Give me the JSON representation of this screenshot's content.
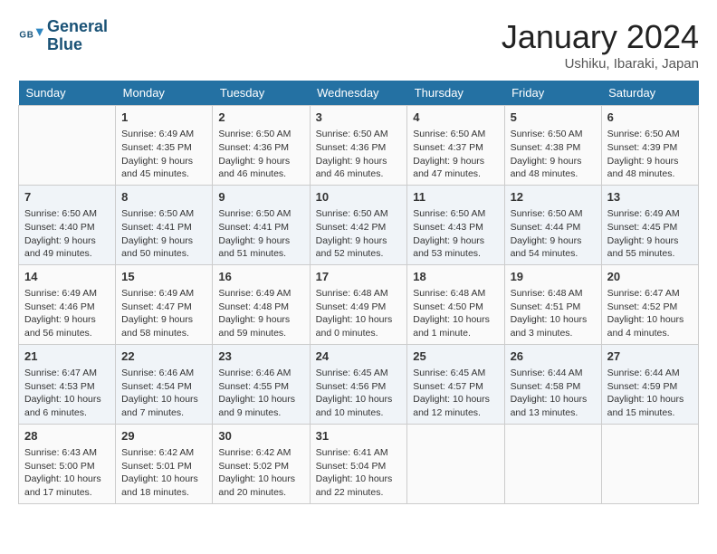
{
  "header": {
    "logo_line1": "General",
    "logo_line2": "Blue",
    "main_title": "January 2024",
    "subtitle": "Ushiku, Ibaraki, Japan"
  },
  "days": [
    "Sunday",
    "Monday",
    "Tuesday",
    "Wednesday",
    "Thursday",
    "Friday",
    "Saturday"
  ],
  "weeks": [
    [
      {
        "date": "",
        "info": ""
      },
      {
        "date": "1",
        "info": "Sunrise: 6:49 AM\nSunset: 4:35 PM\nDaylight: 9 hours\nand 45 minutes."
      },
      {
        "date": "2",
        "info": "Sunrise: 6:50 AM\nSunset: 4:36 PM\nDaylight: 9 hours\nand 46 minutes."
      },
      {
        "date": "3",
        "info": "Sunrise: 6:50 AM\nSunset: 4:36 PM\nDaylight: 9 hours\nand 46 minutes."
      },
      {
        "date": "4",
        "info": "Sunrise: 6:50 AM\nSunset: 4:37 PM\nDaylight: 9 hours\nand 47 minutes."
      },
      {
        "date": "5",
        "info": "Sunrise: 6:50 AM\nSunset: 4:38 PM\nDaylight: 9 hours\nand 48 minutes."
      },
      {
        "date": "6",
        "info": "Sunrise: 6:50 AM\nSunset: 4:39 PM\nDaylight: 9 hours\nand 48 minutes."
      }
    ],
    [
      {
        "date": "7",
        "info": "Sunrise: 6:50 AM\nSunset: 4:40 PM\nDaylight: 9 hours\nand 49 minutes."
      },
      {
        "date": "8",
        "info": "Sunrise: 6:50 AM\nSunset: 4:41 PM\nDaylight: 9 hours\nand 50 minutes."
      },
      {
        "date": "9",
        "info": "Sunrise: 6:50 AM\nSunset: 4:41 PM\nDaylight: 9 hours\nand 51 minutes."
      },
      {
        "date": "10",
        "info": "Sunrise: 6:50 AM\nSunset: 4:42 PM\nDaylight: 9 hours\nand 52 minutes."
      },
      {
        "date": "11",
        "info": "Sunrise: 6:50 AM\nSunset: 4:43 PM\nDaylight: 9 hours\nand 53 minutes."
      },
      {
        "date": "12",
        "info": "Sunrise: 6:50 AM\nSunset: 4:44 PM\nDaylight: 9 hours\nand 54 minutes."
      },
      {
        "date": "13",
        "info": "Sunrise: 6:49 AM\nSunset: 4:45 PM\nDaylight: 9 hours\nand 55 minutes."
      }
    ],
    [
      {
        "date": "14",
        "info": "Sunrise: 6:49 AM\nSunset: 4:46 PM\nDaylight: 9 hours\nand 56 minutes."
      },
      {
        "date": "15",
        "info": "Sunrise: 6:49 AM\nSunset: 4:47 PM\nDaylight: 9 hours\nand 58 minutes."
      },
      {
        "date": "16",
        "info": "Sunrise: 6:49 AM\nSunset: 4:48 PM\nDaylight: 9 hours\nand 59 minutes."
      },
      {
        "date": "17",
        "info": "Sunrise: 6:48 AM\nSunset: 4:49 PM\nDaylight: 10 hours\nand 0 minutes."
      },
      {
        "date": "18",
        "info": "Sunrise: 6:48 AM\nSunset: 4:50 PM\nDaylight: 10 hours\nand 1 minute."
      },
      {
        "date": "19",
        "info": "Sunrise: 6:48 AM\nSunset: 4:51 PM\nDaylight: 10 hours\nand 3 minutes."
      },
      {
        "date": "20",
        "info": "Sunrise: 6:47 AM\nSunset: 4:52 PM\nDaylight: 10 hours\nand 4 minutes."
      }
    ],
    [
      {
        "date": "21",
        "info": "Sunrise: 6:47 AM\nSunset: 4:53 PM\nDaylight: 10 hours\nand 6 minutes."
      },
      {
        "date": "22",
        "info": "Sunrise: 6:46 AM\nSunset: 4:54 PM\nDaylight: 10 hours\nand 7 minutes."
      },
      {
        "date": "23",
        "info": "Sunrise: 6:46 AM\nSunset: 4:55 PM\nDaylight: 10 hours\nand 9 minutes."
      },
      {
        "date": "24",
        "info": "Sunrise: 6:45 AM\nSunset: 4:56 PM\nDaylight: 10 hours\nand 10 minutes."
      },
      {
        "date": "25",
        "info": "Sunrise: 6:45 AM\nSunset: 4:57 PM\nDaylight: 10 hours\nand 12 minutes."
      },
      {
        "date": "26",
        "info": "Sunrise: 6:44 AM\nSunset: 4:58 PM\nDaylight: 10 hours\nand 13 minutes."
      },
      {
        "date": "27",
        "info": "Sunrise: 6:44 AM\nSunset: 4:59 PM\nDaylight: 10 hours\nand 15 minutes."
      }
    ],
    [
      {
        "date": "28",
        "info": "Sunrise: 6:43 AM\nSunset: 5:00 PM\nDaylight: 10 hours\nand 17 minutes."
      },
      {
        "date": "29",
        "info": "Sunrise: 6:42 AM\nSunset: 5:01 PM\nDaylight: 10 hours\nand 18 minutes."
      },
      {
        "date": "30",
        "info": "Sunrise: 6:42 AM\nSunset: 5:02 PM\nDaylight: 10 hours\nand 20 minutes."
      },
      {
        "date": "31",
        "info": "Sunrise: 6:41 AM\nSunset: 5:04 PM\nDaylight: 10 hours\nand 22 minutes."
      },
      {
        "date": "",
        "info": ""
      },
      {
        "date": "",
        "info": ""
      },
      {
        "date": "",
        "info": ""
      }
    ]
  ]
}
